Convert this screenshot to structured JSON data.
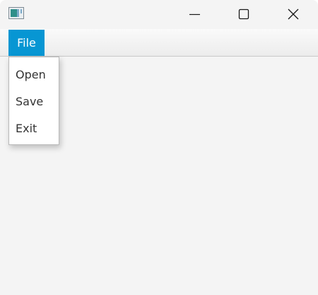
{
  "window": {
    "title": "",
    "icon": "app-window-icon",
    "controls": [
      "minimize-icon",
      "maximize-icon",
      "close-icon"
    ]
  },
  "menubar": {
    "menus": [
      {
        "label": "File",
        "active": true
      }
    ]
  },
  "file_menu": {
    "items": [
      {
        "label": "Open"
      },
      {
        "label": "Save"
      },
      {
        "label": "Exit"
      }
    ]
  },
  "colors": {
    "accent": "#0796d3",
    "background": "#f4f4f4",
    "menu_text": "#333333"
  }
}
